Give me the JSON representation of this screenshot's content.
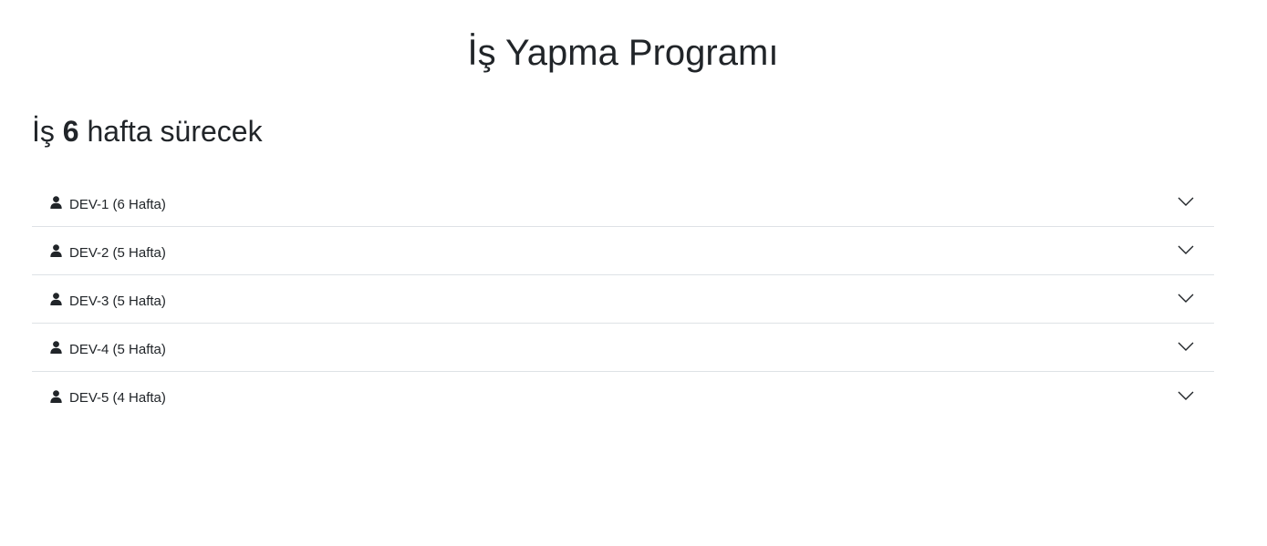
{
  "header": {
    "title": "İş Yapma Programı"
  },
  "summary": {
    "prefix": "İş",
    "weeks": "6",
    "suffix": "hafta sürecek"
  },
  "accordion": {
    "items": [
      {
        "label": "DEV-1 (6 Hafta)"
      },
      {
        "label": "DEV-2 (5 Hafta)"
      },
      {
        "label": "DEV-3 (5 Hafta)"
      },
      {
        "label": "DEV-4 (5 Hafta)"
      },
      {
        "label": "DEV-5 (4 Hafta)"
      }
    ]
  },
  "icons": {
    "item_icon": "user-icon",
    "toggle_icon": "chevron-down-icon"
  },
  "colors": {
    "text": "#212529",
    "divider": "#dee2e6",
    "background": "#ffffff"
  }
}
